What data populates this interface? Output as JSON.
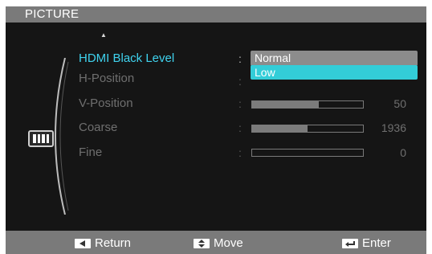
{
  "title": "PICTURE",
  "scroll_up_icon": "triangle-up",
  "category_icon": "picture-category-icon",
  "menu": {
    "items": [
      {
        "label": "HDMI Black Level",
        "active": true
      },
      {
        "label": "H-Position",
        "active": false
      },
      {
        "label": "V-Position",
        "active": false,
        "value": "50",
        "level": 0.6
      },
      {
        "label": "Coarse",
        "active": false,
        "value": "1936",
        "level": 0.5
      },
      {
        "label": "Fine",
        "active": false,
        "value": "0",
        "level": 0.0
      }
    ],
    "separator": ":"
  },
  "dropdown": {
    "options": [
      "Normal",
      "Low"
    ],
    "selected": "Low"
  },
  "footer": {
    "return_label": "Return",
    "move_label": "Move",
    "enter_label": "Enter"
  },
  "colors": {
    "accent": "#3fd3ef",
    "selected_option": "#33cdd8",
    "highlight_option": "#8c8c8c",
    "background": "#151515",
    "bars": "#7a7a7a"
  }
}
